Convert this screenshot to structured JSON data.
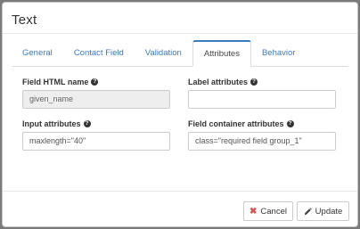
{
  "dialog": {
    "title": "Text"
  },
  "tabs": [
    {
      "label": "General",
      "active": false
    },
    {
      "label": "Contact Field",
      "active": false
    },
    {
      "label": "Validation",
      "active": false
    },
    {
      "label": "Attributes",
      "active": true
    },
    {
      "label": "Behavior",
      "active": false
    }
  ],
  "fields": {
    "html_name": {
      "label": "Field HTML name",
      "value": "given_name",
      "readonly": true
    },
    "label_attributes": {
      "label": "Label attributes",
      "value": ""
    },
    "input_attributes": {
      "label": "Input attributes",
      "value": "maxlength=\"40\""
    },
    "container_attributes": {
      "label": "Field container attributes",
      "value": "class=\"required field group_1\""
    }
  },
  "icons": {
    "help": "question-circle-icon",
    "cancel": "times-icon",
    "update": "pencil-icon"
  },
  "help_glyph": "?",
  "buttons": {
    "cancel": "Cancel",
    "update": "Update",
    "cancel_glyph": "✖"
  },
  "colors": {
    "accent": "#3a7bbf",
    "danger": "#d9534f"
  }
}
